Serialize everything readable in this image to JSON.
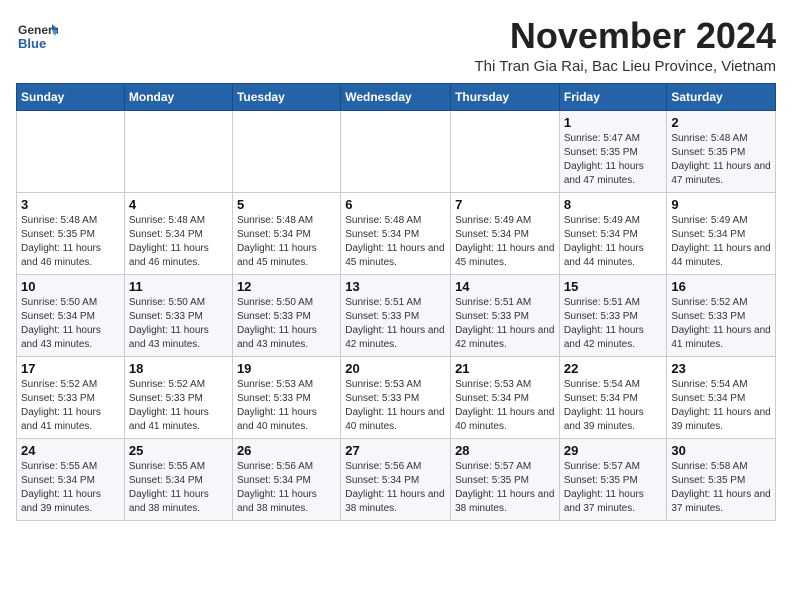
{
  "logo": {
    "line1": "General",
    "line2": "Blue"
  },
  "header": {
    "month_year": "November 2024",
    "location": "Thi Tran Gia Rai, Bac Lieu Province, Vietnam"
  },
  "weekdays": [
    "Sunday",
    "Monday",
    "Tuesday",
    "Wednesday",
    "Thursday",
    "Friday",
    "Saturday"
  ],
  "weeks": [
    [
      {
        "day": "",
        "info": ""
      },
      {
        "day": "",
        "info": ""
      },
      {
        "day": "",
        "info": ""
      },
      {
        "day": "",
        "info": ""
      },
      {
        "day": "",
        "info": ""
      },
      {
        "day": "1",
        "info": "Sunrise: 5:47 AM\nSunset: 5:35 PM\nDaylight: 11 hours and 47 minutes."
      },
      {
        "day": "2",
        "info": "Sunrise: 5:48 AM\nSunset: 5:35 PM\nDaylight: 11 hours and 47 minutes."
      }
    ],
    [
      {
        "day": "3",
        "info": "Sunrise: 5:48 AM\nSunset: 5:35 PM\nDaylight: 11 hours and 46 minutes."
      },
      {
        "day": "4",
        "info": "Sunrise: 5:48 AM\nSunset: 5:34 PM\nDaylight: 11 hours and 46 minutes."
      },
      {
        "day": "5",
        "info": "Sunrise: 5:48 AM\nSunset: 5:34 PM\nDaylight: 11 hours and 45 minutes."
      },
      {
        "day": "6",
        "info": "Sunrise: 5:48 AM\nSunset: 5:34 PM\nDaylight: 11 hours and 45 minutes."
      },
      {
        "day": "7",
        "info": "Sunrise: 5:49 AM\nSunset: 5:34 PM\nDaylight: 11 hours and 45 minutes."
      },
      {
        "day": "8",
        "info": "Sunrise: 5:49 AM\nSunset: 5:34 PM\nDaylight: 11 hours and 44 minutes."
      },
      {
        "day": "9",
        "info": "Sunrise: 5:49 AM\nSunset: 5:34 PM\nDaylight: 11 hours and 44 minutes."
      }
    ],
    [
      {
        "day": "10",
        "info": "Sunrise: 5:50 AM\nSunset: 5:34 PM\nDaylight: 11 hours and 43 minutes."
      },
      {
        "day": "11",
        "info": "Sunrise: 5:50 AM\nSunset: 5:33 PM\nDaylight: 11 hours and 43 minutes."
      },
      {
        "day": "12",
        "info": "Sunrise: 5:50 AM\nSunset: 5:33 PM\nDaylight: 11 hours and 43 minutes."
      },
      {
        "day": "13",
        "info": "Sunrise: 5:51 AM\nSunset: 5:33 PM\nDaylight: 11 hours and 42 minutes."
      },
      {
        "day": "14",
        "info": "Sunrise: 5:51 AM\nSunset: 5:33 PM\nDaylight: 11 hours and 42 minutes."
      },
      {
        "day": "15",
        "info": "Sunrise: 5:51 AM\nSunset: 5:33 PM\nDaylight: 11 hours and 42 minutes."
      },
      {
        "day": "16",
        "info": "Sunrise: 5:52 AM\nSunset: 5:33 PM\nDaylight: 11 hours and 41 minutes."
      }
    ],
    [
      {
        "day": "17",
        "info": "Sunrise: 5:52 AM\nSunset: 5:33 PM\nDaylight: 11 hours and 41 minutes."
      },
      {
        "day": "18",
        "info": "Sunrise: 5:52 AM\nSunset: 5:33 PM\nDaylight: 11 hours and 41 minutes."
      },
      {
        "day": "19",
        "info": "Sunrise: 5:53 AM\nSunset: 5:33 PM\nDaylight: 11 hours and 40 minutes."
      },
      {
        "day": "20",
        "info": "Sunrise: 5:53 AM\nSunset: 5:33 PM\nDaylight: 11 hours and 40 minutes."
      },
      {
        "day": "21",
        "info": "Sunrise: 5:53 AM\nSunset: 5:34 PM\nDaylight: 11 hours and 40 minutes."
      },
      {
        "day": "22",
        "info": "Sunrise: 5:54 AM\nSunset: 5:34 PM\nDaylight: 11 hours and 39 minutes."
      },
      {
        "day": "23",
        "info": "Sunrise: 5:54 AM\nSunset: 5:34 PM\nDaylight: 11 hours and 39 minutes."
      }
    ],
    [
      {
        "day": "24",
        "info": "Sunrise: 5:55 AM\nSunset: 5:34 PM\nDaylight: 11 hours and 39 minutes."
      },
      {
        "day": "25",
        "info": "Sunrise: 5:55 AM\nSunset: 5:34 PM\nDaylight: 11 hours and 38 minutes."
      },
      {
        "day": "26",
        "info": "Sunrise: 5:56 AM\nSunset: 5:34 PM\nDaylight: 11 hours and 38 minutes."
      },
      {
        "day": "27",
        "info": "Sunrise: 5:56 AM\nSunset: 5:34 PM\nDaylight: 11 hours and 38 minutes."
      },
      {
        "day": "28",
        "info": "Sunrise: 5:57 AM\nSunset: 5:35 PM\nDaylight: 11 hours and 38 minutes."
      },
      {
        "day": "29",
        "info": "Sunrise: 5:57 AM\nSunset: 5:35 PM\nDaylight: 11 hours and 37 minutes."
      },
      {
        "day": "30",
        "info": "Sunrise: 5:58 AM\nSunset: 5:35 PM\nDaylight: 11 hours and 37 minutes."
      }
    ]
  ]
}
